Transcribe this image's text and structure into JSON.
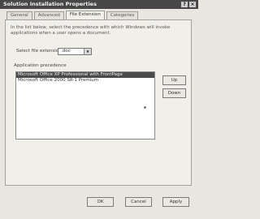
{
  "window": {
    "title": "Solution Installation Properties",
    "help_glyph": "?",
    "close_glyph": "×"
  },
  "tabs": [
    {
      "label": "General"
    },
    {
      "label": "Advanced"
    },
    {
      "label": "File Extension",
      "active": true
    },
    {
      "label": "Categories"
    }
  ],
  "file_extension": {
    "description": "In the list below, select the precedence with which Windows will invoke applications when a user opens a document.",
    "select_label": "Select file extension:",
    "selected_extension": ".doc",
    "applications_label": "Application precedence",
    "applications": [
      {
        "name": "Microsoft Office XP Professional with FrontPage",
        "selected": true
      },
      {
        "name": "Microsoft Office 2000 SR-1 Premium",
        "selected": false
      }
    ],
    "up_button": "Up",
    "down_button": "Down"
  },
  "footer": {
    "ok": "OK",
    "cancel": "Cancel",
    "apply": "Apply"
  }
}
